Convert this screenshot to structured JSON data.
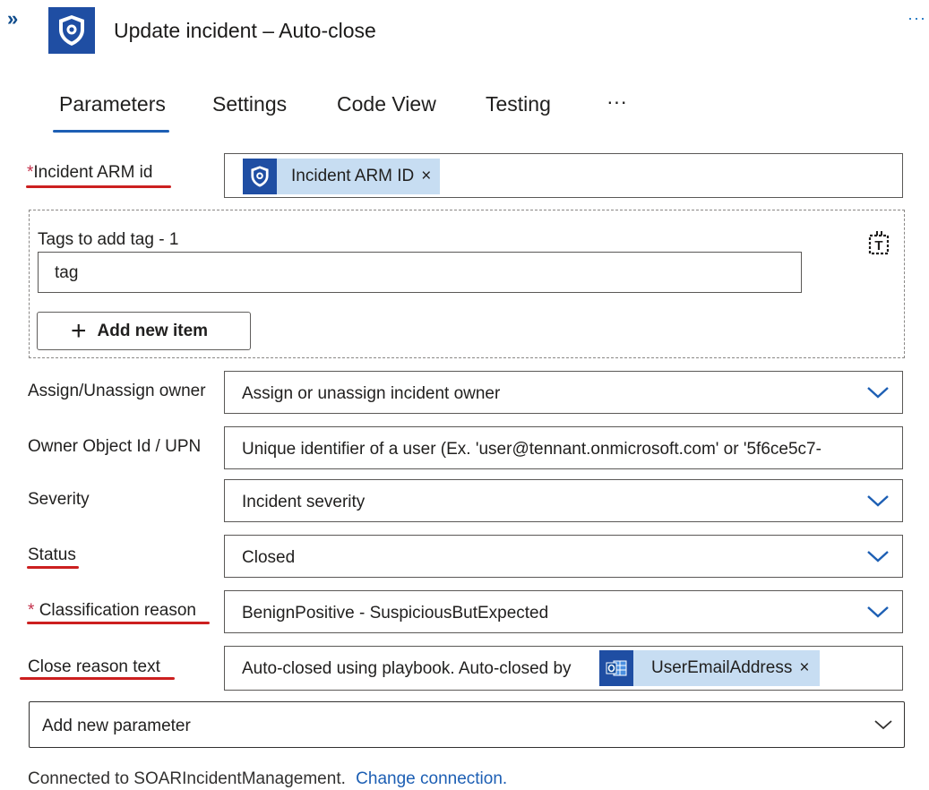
{
  "header": {
    "expand_glyph": "»",
    "title": "Update incident – Auto-close",
    "more_glyph": "···",
    "app_icon": "sentinel-shield-icon"
  },
  "tabs": [
    {
      "label": "Parameters",
      "active": true
    },
    {
      "label": "Settings"
    },
    {
      "label": "Code View"
    },
    {
      "label": "Testing"
    },
    {
      "label": "···"
    }
  ],
  "params": {
    "arm": {
      "required_mark": "*",
      "label": "Incident ARM id",
      "token_label": "Incident ARM ID",
      "token_close": "×"
    },
    "tags": {
      "label": "Tags to add tag - 1",
      "value": "tag",
      "add_button_plus": "+",
      "add_button_label": "Add new item",
      "toggle_icon": "text-mode-toggle-icon"
    },
    "owner": {
      "label": "Assign/Unassign owner",
      "value": "Assign or unassign incident owner"
    },
    "owner_id": {
      "label": "Owner Object Id / UPN",
      "placeholder": "Unique identifier of a user (Ex. 'user@tennant.onmicrosoft.com' or '5f6ce5c7-"
    },
    "severity": {
      "label": "Severity",
      "value": "Incident severity"
    },
    "status": {
      "label": "Status",
      "value": "Closed"
    },
    "classification": {
      "required_mark": "*",
      "label": "Classification reason",
      "value": "BenignPositive - SuspiciousButExpected"
    },
    "close_reason": {
      "label": "Close reason text",
      "value": "Auto-closed using playbook. Auto-closed by",
      "token_label": "UserEmailAddress",
      "token_close": "×",
      "token_icon": "outlook-icon"
    },
    "add_param": {
      "value": "Add new parameter"
    }
  },
  "footer": {
    "connected_text": "Connected to SOARIncidentManagement.",
    "change_link": "Change connection."
  },
  "colors": {
    "brand": "#1f4ea3",
    "accent": "#1d5fb4",
    "token_bg": "#c7ddf2",
    "annotation_red": "#cc1f1f"
  }
}
